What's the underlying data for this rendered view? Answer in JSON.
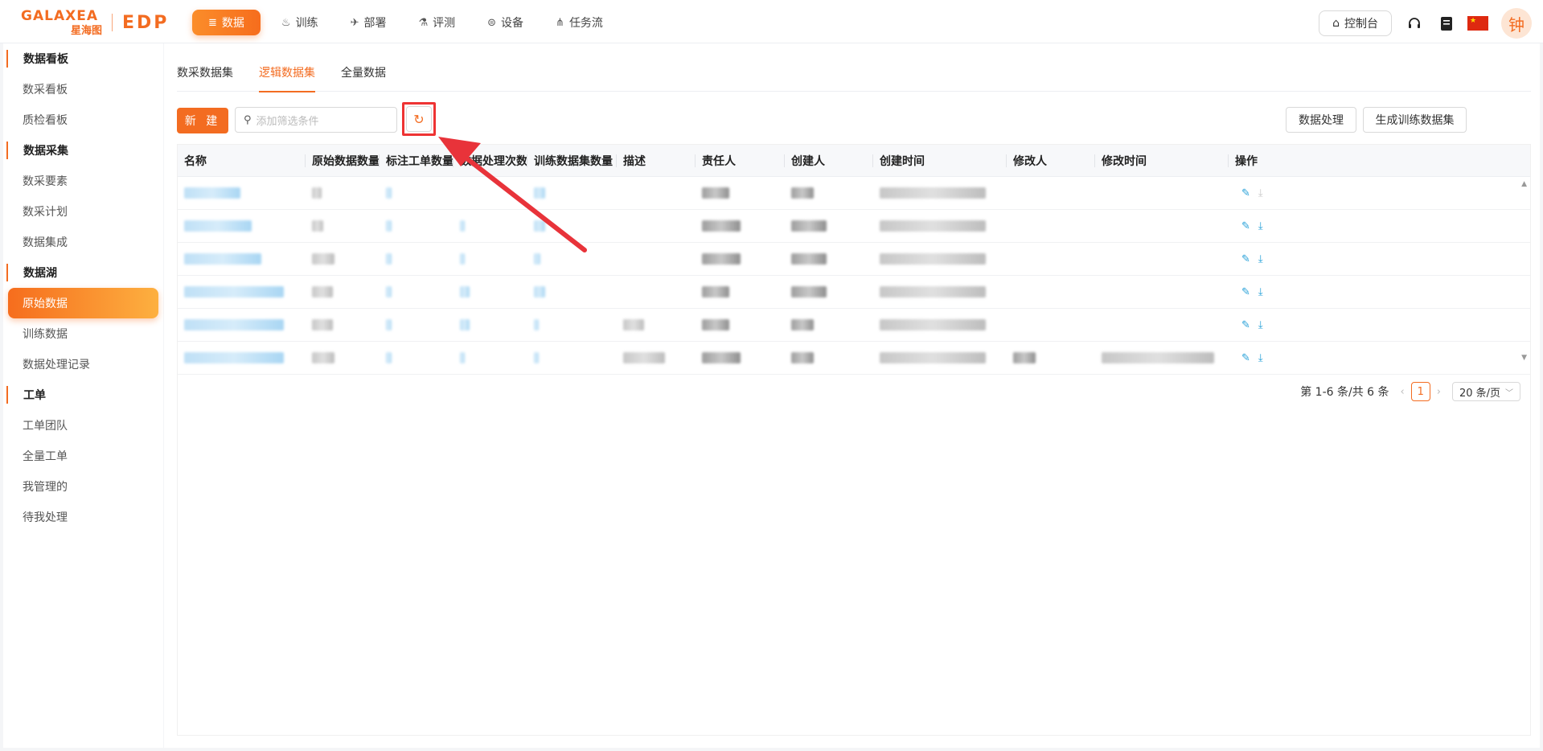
{
  "brand": {
    "name": "GALAXEA",
    "sub": "星海图",
    "product": "EDP"
  },
  "nav": [
    {
      "label": "数据",
      "icon": "database-icon",
      "glyph": "≣",
      "active": true
    },
    {
      "label": "训练",
      "icon": "flame-icon",
      "glyph": "♨",
      "active": false
    },
    {
      "label": "部署",
      "icon": "rocket-icon",
      "glyph": "✈",
      "active": false
    },
    {
      "label": "评测",
      "icon": "flask-icon",
      "glyph": "⚗",
      "active": false
    },
    {
      "label": "设备",
      "icon": "robot-icon",
      "glyph": "⊜",
      "active": false
    },
    {
      "label": "任务流",
      "icon": "workflow-icon",
      "glyph": "⋔",
      "active": false
    }
  ],
  "top_right": {
    "console_label": "控制台",
    "avatar_text": "钟"
  },
  "sidebar": [
    {
      "type": "group",
      "label": "数据看板"
    },
    {
      "type": "item",
      "label": "数采看板"
    },
    {
      "type": "item",
      "label": "质检看板"
    },
    {
      "type": "group",
      "label": "数据采集"
    },
    {
      "type": "item",
      "label": "数采要素"
    },
    {
      "type": "item",
      "label": "数采计划"
    },
    {
      "type": "item",
      "label": "数据集成"
    },
    {
      "type": "group",
      "label": "数据湖"
    },
    {
      "type": "item",
      "label": "原始数据",
      "active": true
    },
    {
      "type": "item",
      "label": "训练数据"
    },
    {
      "type": "item",
      "label": "数据处理记录"
    },
    {
      "type": "group",
      "label": "工单"
    },
    {
      "type": "item",
      "label": "工单团队"
    },
    {
      "type": "item",
      "label": "全量工单"
    },
    {
      "type": "item",
      "label": "我管理的"
    },
    {
      "type": "item",
      "label": "待我处理"
    }
  ],
  "tabs": [
    {
      "label": "数采数据集",
      "active": false
    },
    {
      "label": "逻辑数据集",
      "active": true
    },
    {
      "label": "全量数据",
      "active": false
    }
  ],
  "toolbar": {
    "new_label": "新 建",
    "search_placeholder": "添加筛选条件",
    "process_label": "数据处理",
    "generate_label": "生成训练数据集"
  },
  "table": {
    "columns": [
      "名称",
      "原始数据数量",
      "标注工单数量",
      "数据处理次数",
      "训练数据集数量",
      "描述",
      "责任人",
      "创建人",
      "创建时间",
      "修改人",
      "修改时间",
      "操作"
    ]
  },
  "pagination": {
    "summary": "第 1-6 条/共 6 条",
    "current": "1",
    "page_size": "20 条/页"
  },
  "colors": {
    "accent": "#f36c21",
    "highlight": "#e33333",
    "link": "#26a0d8"
  }
}
